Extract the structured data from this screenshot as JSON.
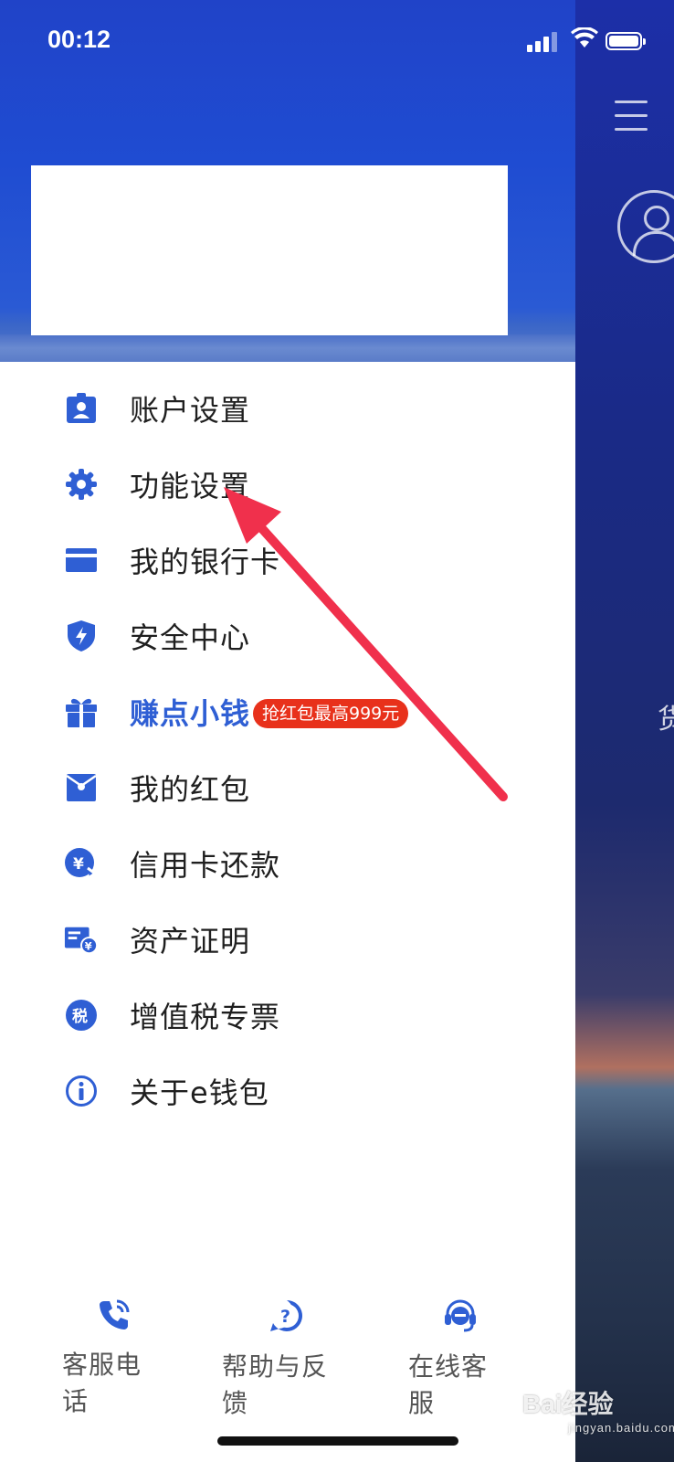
{
  "status_bar": {
    "time": "00:12"
  },
  "drawer": {
    "menu": [
      {
        "label": "账户设置",
        "icon": "account-badge-icon"
      },
      {
        "label": "功能设置",
        "icon": "gear-icon"
      },
      {
        "label": "我的银行卡",
        "icon": "bank-card-icon"
      },
      {
        "label": "安全中心",
        "icon": "shield-icon"
      },
      {
        "label": "赚点小钱",
        "icon": "gift-icon",
        "badge": "抢红包最高999元"
      },
      {
        "label": "我的红包",
        "icon": "red-envelope-icon"
      },
      {
        "label": "信用卡还款",
        "icon": "credit-repay-icon"
      },
      {
        "label": "资产证明",
        "icon": "asset-certificate-icon"
      },
      {
        "label": "增值税专票",
        "icon": "tax-icon"
      },
      {
        "label": "关于e钱包",
        "icon": "info-icon"
      }
    ],
    "bottom_actions": [
      {
        "label": "客服电话",
        "icon": "phone-icon"
      },
      {
        "label": "帮助与反馈",
        "icon": "help-icon"
      },
      {
        "label": "在线客服",
        "icon": "headset-icon"
      }
    ]
  },
  "background": {
    "partial_glyph": "货"
  },
  "watermark": {
    "brand": "Bai",
    "site": "经验",
    "url": "jingyan.baidu.com"
  },
  "colors": {
    "accent": "#2f5fd4",
    "badge": "#e8311b",
    "arrow": "#f0304c"
  }
}
